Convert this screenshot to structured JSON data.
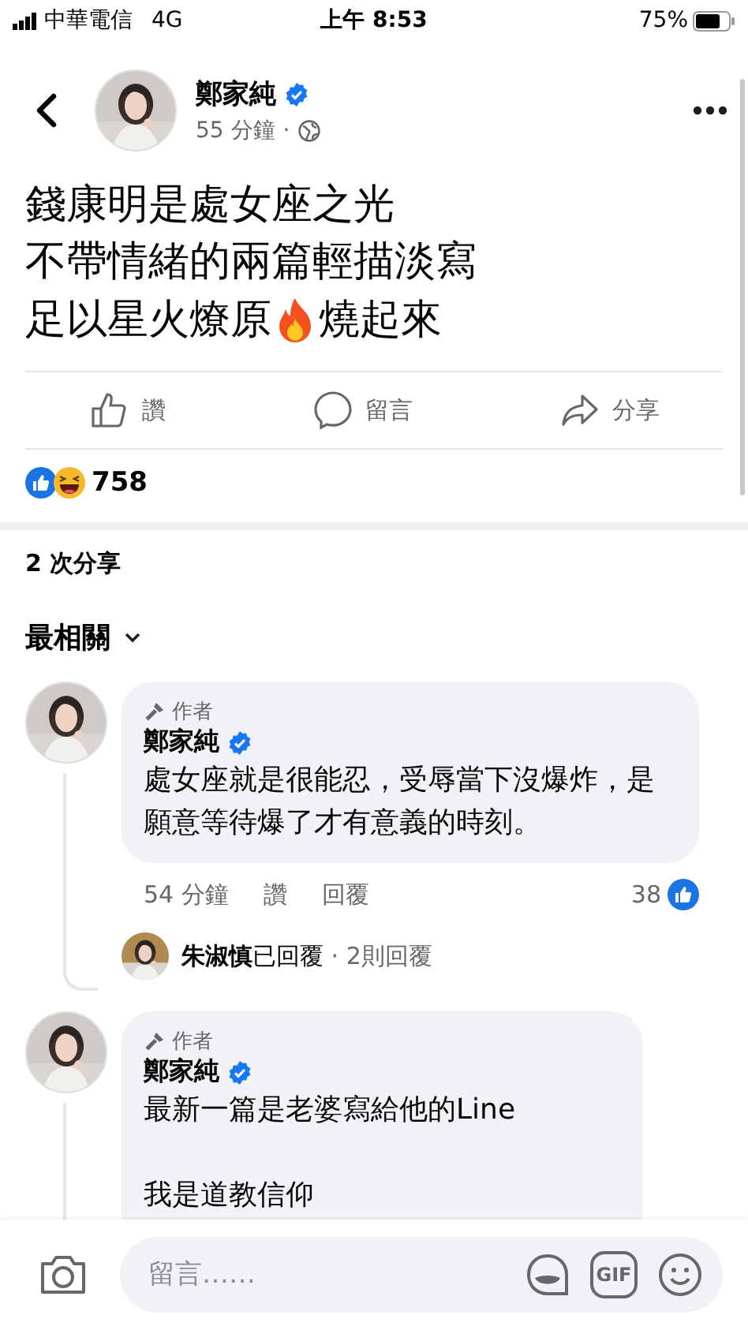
{
  "status_bar": {
    "carrier": "中華電信",
    "network": "4G",
    "time": "上午 8:53",
    "battery": "75%"
  },
  "post": {
    "author": "鄭家純",
    "verified": true,
    "time": "55 分鐘",
    "dot": "·",
    "lines": [
      {
        "text": "錢康明是處女座之光"
      },
      {
        "text": "不帶情緒的兩篇輕描淡寫"
      },
      {
        "text": "足以星火燎原",
        "text_after_icon": "燒起來"
      }
    ],
    "actions": [
      {
        "kind": "like",
        "label": "讚"
      },
      {
        "kind": "comment",
        "label": "留言"
      },
      {
        "kind": "share",
        "label": "分享"
      }
    ],
    "reaction_count": "758",
    "shares": "2 次分享"
  },
  "sort": {
    "label": "最相關"
  },
  "comments": [
    {
      "badge": "作者",
      "author": "鄭家純",
      "verified": true,
      "text": "處女座就是很能忍，受辱當下沒爆炸，是願意等待爆了才有意義的時刻。",
      "meta": {
        "time": "54 分鐘",
        "like": "讚",
        "reply": "回覆",
        "like_count": "38"
      },
      "replies": {
        "name": "朱淑慎",
        "action": "已回覆",
        "dot": "·",
        "count": "2則回覆"
      }
    },
    {
      "badge": "作者",
      "author": "鄭家純",
      "verified": true,
      "text": "最新一篇是老婆寫給他的Line\n\n我是道教信仰"
    }
  ],
  "composer": {
    "placeholder": "留言……",
    "gif_label": "GIF"
  }
}
